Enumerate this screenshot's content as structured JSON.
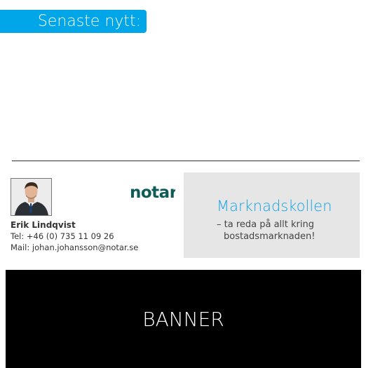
{
  "news": {
    "header": "Senaste nytt:"
  },
  "contact": {
    "name": "Erik Lindqvist",
    "phone": "Tel: +46 (0) 735 11 09 26",
    "mail": "Mail: johan.johansson@notar.se"
  },
  "brand": {
    "logo_text": "notar",
    "logo_color": "#0f5b58"
  },
  "promo": {
    "title": "Marknadskollen",
    "line1": "– ta reda på allt kring",
    "line2": "bostadsmarknaden!"
  },
  "banner": {
    "label": "BANNER"
  },
  "colors": {
    "accent": "#00a6e8",
    "promo_bg": "#e6e6e6",
    "banner_bg": "#000000"
  }
}
